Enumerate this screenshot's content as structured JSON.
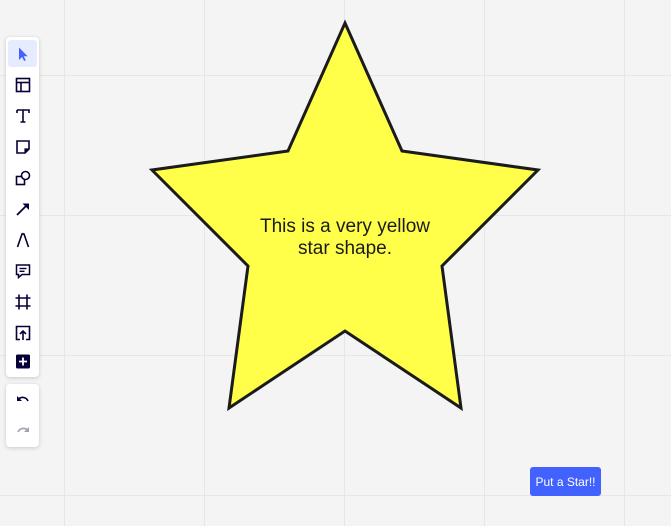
{
  "canvas": {
    "shape": {
      "type": "star",
      "fill": "#ffff4a",
      "stroke": "#1b1b1b",
      "label_line1": "This is a very yellow",
      "label_line2": "star shape."
    }
  },
  "toolbar": {
    "tools": [
      {
        "name": "select",
        "icon": "cursor-icon",
        "active": true
      },
      {
        "name": "templates",
        "icon": "layout-icon"
      },
      {
        "name": "text",
        "icon": "text-icon"
      },
      {
        "name": "sticky-note",
        "icon": "sticky-note-icon"
      },
      {
        "name": "shapes",
        "icon": "shapes-icon"
      },
      {
        "name": "connection-line",
        "icon": "arrow-icon"
      },
      {
        "name": "pen",
        "icon": "pen-icon"
      },
      {
        "name": "comment",
        "icon": "comment-icon"
      },
      {
        "name": "frame",
        "icon": "frame-icon"
      },
      {
        "name": "upload",
        "icon": "upload-icon"
      },
      {
        "name": "more-apps",
        "icon": "add-icon"
      }
    ],
    "history": [
      {
        "name": "undo",
        "icon": "undo-icon"
      },
      {
        "name": "redo",
        "icon": "redo-icon"
      }
    ]
  },
  "actions": {
    "put_star_label": "Put a Star!!"
  },
  "colors": {
    "accent": "#4262ff",
    "active_tool_bg": "#e7ebff",
    "icon": "#050038",
    "disabled_icon": "#a0a0b0"
  }
}
